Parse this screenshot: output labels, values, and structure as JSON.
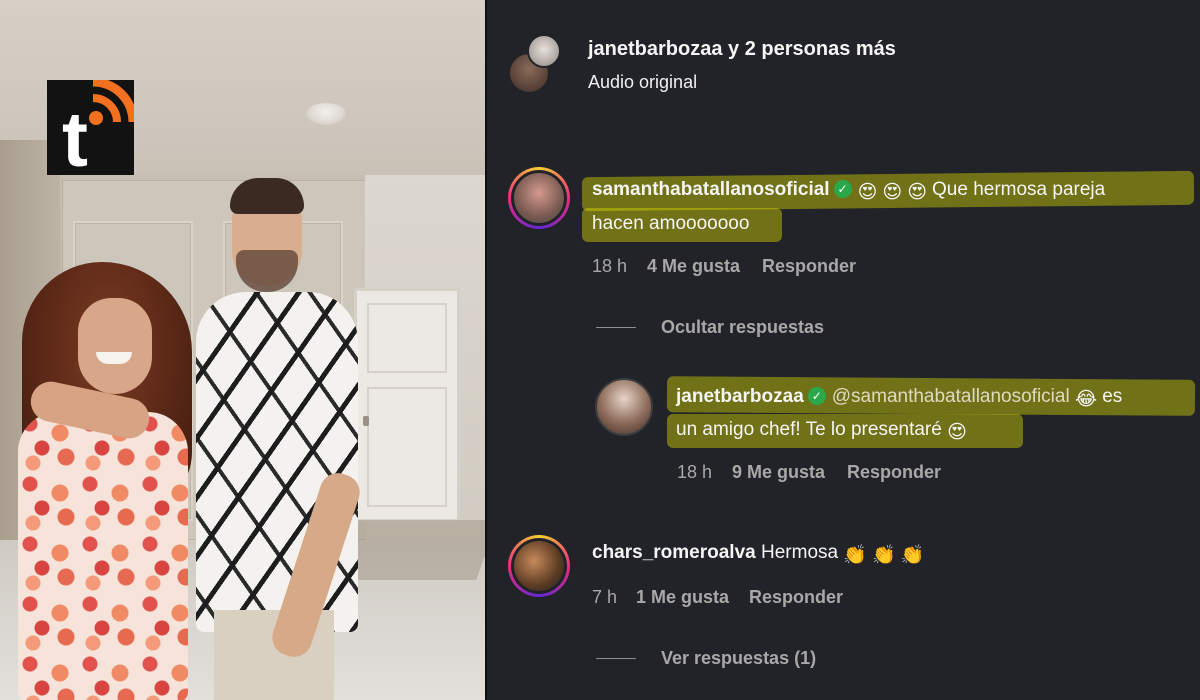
{
  "post": {
    "author_line": "janetbarbozaa y 2 personas más",
    "audio_label": "Audio original"
  },
  "brand": {
    "logo_letter": "t",
    "accent_color": "#f37021"
  },
  "comments": [
    {
      "username": "samanthabatallanosoficial",
      "verified": true,
      "text_line1": "Que hermosa pareja",
      "text_line2": "hacen amooooooo",
      "time": "18 h",
      "likes": "4 Me gusta",
      "reply_label": "Responder",
      "toggle_replies": "Ocultar respuestas",
      "replies": [
        {
          "username": "janetbarbozaa",
          "verified": true,
          "mention": "@samanthabatallanosoficial",
          "text_line1_end": "es",
          "text_line2": "un amigo chef! Te lo presentaré",
          "time": "18 h",
          "likes": "9 Me gusta",
          "reply_label": "Responder"
        }
      ]
    },
    {
      "username": "chars_romeroalva",
      "verified": false,
      "text": "Hermosa",
      "time": "7 h",
      "likes": "1 Me gusta",
      "reply_label": "Responder",
      "toggle_replies": "Ver respuestas (1)"
    }
  ],
  "emoji_icons": [
    "heart-eyes-emoji",
    "tears-of-joy-emoji",
    "clapping-hands-emoji"
  ]
}
